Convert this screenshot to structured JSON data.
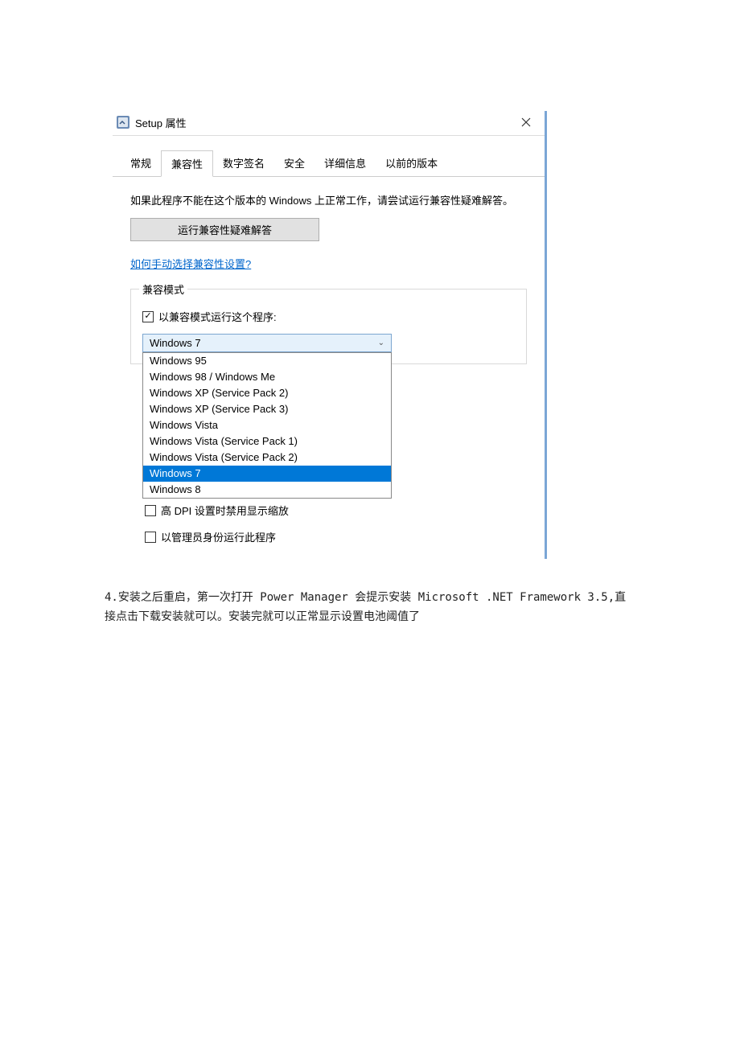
{
  "titlebar": {
    "title": "Setup 属性"
  },
  "tabs": [
    {
      "label": "常规"
    },
    {
      "label": "兼容性"
    },
    {
      "label": "数字签名"
    },
    {
      "label": "安全"
    },
    {
      "label": "详细信息"
    },
    {
      "label": "以前的版本"
    }
  ],
  "content": {
    "intro": "如果此程序不能在这个版本的 Windows 上正常工作，请尝试运行兼容性疑难解答。",
    "troubleshoot_button": "运行兼容性疑难解答",
    "help_link": "如何手动选择兼容性设置?"
  },
  "compat_mode": {
    "legend": "兼容模式",
    "checkbox_label": "以兼容模式运行这个程序:"
  },
  "combo": {
    "selected": "Windows 7",
    "options": [
      "Windows 95",
      "Windows 98 / Windows Me",
      "Windows XP (Service Pack 2)",
      "Windows XP (Service Pack 3)",
      "Windows Vista",
      "Windows Vista (Service Pack 1)",
      "Windows Vista (Service Pack 2)",
      "Windows 7",
      "Windows 8"
    ]
  },
  "dpi_checkbox": "高 DPI 设置时禁用显示缩放",
  "admin_checkbox": "以管理员身份运行此程序",
  "footer": "4.安装之后重启，第一次打开 Power Manager 会提示安装 Microsoft .NET Framework 3.5,直接点击下载安装就可以。安装完就可以正常显示设置电池阈值了"
}
